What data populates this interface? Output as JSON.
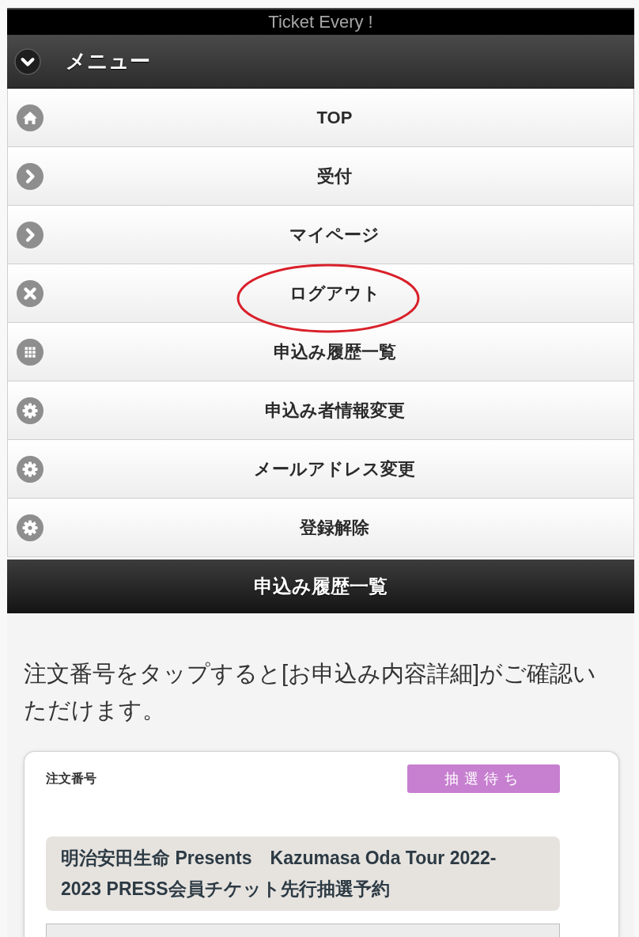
{
  "app_bar": {
    "title": "Ticket Every !"
  },
  "menu": {
    "title": "メニュー",
    "expanded": true,
    "items": [
      {
        "label": "TOP",
        "kind": "home",
        "circled": false
      },
      {
        "label": "受付",
        "kind": "arrow",
        "circled": false
      },
      {
        "label": "マイページ",
        "kind": "arrow",
        "circled": false
      },
      {
        "label": "ログアウト",
        "kind": "close",
        "circled": true
      },
      {
        "label": "申込み履歴一覧",
        "kind": "grid",
        "circled": false
      },
      {
        "label": "申込み者情報変更",
        "kind": "gear",
        "circled": false
      },
      {
        "label": "メールアドレス変更",
        "kind": "gear",
        "circled": false
      },
      {
        "label": "登録解除",
        "kind": "gear",
        "circled": false
      }
    ]
  },
  "section": {
    "title": "申込み履歴一覧",
    "note": "注文番号をタップすると[お申込み内容詳細]がご確認いただけます。"
  },
  "orders": [
    {
      "order_number_label": "注文番号",
      "status": {
        "label": "抽選待ち",
        "color": "#c77fd0"
      },
      "event_title": "明治安田生命 Presents　Kazumasa Oda Tour 2022-2023 PRESS会員チケット先行抽選予約"
    }
  ]
}
